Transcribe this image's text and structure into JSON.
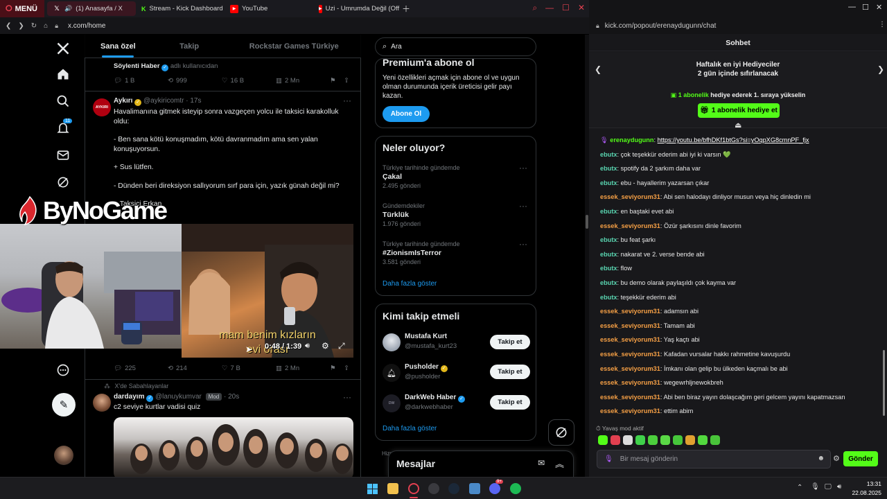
{
  "left_browser": {
    "menu_label": "MENÜ",
    "tabs": [
      {
        "label": "(1) Anasayfa / X",
        "active": true
      },
      {
        "label": "Stream - Kick Dashboard",
        "active": false
      },
      {
        "label": "YouTube",
        "active": false
      },
      {
        "label": "Uzi - Umrumda Değil (Off",
        "active": false
      }
    ],
    "url": "x.com/home"
  },
  "x": {
    "notif_count": "11",
    "timeline_tabs": [
      "Sana özel",
      "Takip",
      "Rockstar Games Türkiye"
    ],
    "tweet0": {
      "author": "Söylenti Haber",
      "handle": "adlı kullanıcıdan",
      "replies": "1 B",
      "retweets": "999",
      "likes": "16 B",
      "views": "2 Mn"
    },
    "tweet1": {
      "author": "Aykırı",
      "handle": "@aykiricomtr · 17s",
      "avatar_text": "AYKIRI",
      "lines": [
        "Havalimanına gitmek isteyip sonra vazgeçen yolcu ile taksici karakolluk oldu:",
        "- Ben sana kötü konuşmadım, kötü davranmadım ama sen yalan konuşuyorsun.",
        "+ Sus lütfen.",
        "- Dünden beri direksiyon sallıyorum sırf para için, yazık günah değil mi?",
        "+ Taksici Erkan"
      ],
      "video_subtitle_1": "mam benim kızların",
      "video_subtitle_2": "evi orası",
      "video_time": "0:48 / 1:39",
      "replies": "225",
      "retweets": "214",
      "likes": "7 B",
      "views": "2 Mn"
    },
    "tweet2": {
      "context": "X'de Sabahlayanlar",
      "author": "dardayım",
      "handle": "@lanuykumvar",
      "badge": "Mod",
      "time": "20s",
      "text": "c2 seviye kurtlar vadisi quiz"
    },
    "search_placeholder": "Ara",
    "premium": {
      "title": "Premium'a abone ol",
      "desc": "Yeni özellikleri açmak için abone ol ve uygun olman durumunda içerik üreticisi gelir payı kazan.",
      "button": "Abone Ol"
    },
    "trends": {
      "title": "Neler oluyor?",
      "items": [
        {
          "meta": "Türkiye tarihinde gündemde",
          "name": "Çakal",
          "count": "2.495 gönderi"
        },
        {
          "meta": "Gündemdekiler",
          "name": "Türklük",
          "count": "1.976 gönderi"
        },
        {
          "meta": "Türkiye tarihinde gündemde",
          "name": "#ZionismIsTerror",
          "count": "3.581 gönderi"
        }
      ],
      "more": "Daha fazla göster"
    },
    "who_to_follow": {
      "title": "Kimi takip etmeli",
      "items": [
        {
          "name": "Mustafa Kurt",
          "handle": "@mustafa_kurt23",
          "button": "Takip et"
        },
        {
          "name": "Pusholder",
          "handle": "@pusholder",
          "button": "Takip et"
        },
        {
          "name": "DarkWeb Haber",
          "handle": "@darkwebhaber",
          "button": "Takip et"
        }
      ],
      "more": "Daha fazla göster"
    },
    "messages_label": "Mesajlar",
    "footer_snippet": "Hizm"
  },
  "overlay": {
    "logo_text": "ByNoGame"
  },
  "kick": {
    "url": "kick.com/popout/erenaydugunn/chat",
    "chat_title": "Sohbet",
    "gifters_title": "Haftalık en iyi Hediyeciler",
    "gifters_subtitle": "2 gün içinde sıfırlanacak",
    "gift_promo_bold": "1 abonelik",
    "gift_promo_rest": " hediye ederek 1. sıraya yükselin",
    "gift_button": "1 abonelik hediye et",
    "messages": [
      {
        "user": "erenaydugunn",
        "text": "https://youtu.be/bfhDKf1btGs?si=yOqpXG8cmnPF_fjx",
        "color": "#53fc18",
        "link": true
      },
      {
        "user": "ebutx",
        "text": "çok teşekkür ederim abi iyi ki varsın 💚",
        "color": "#59d4b0"
      },
      {
        "user": "ebutx",
        "text": "spotify da 2 şarkım daha var",
        "color": "#59d4b0"
      },
      {
        "user": "ebutx",
        "text": "ebu - hayallerim yazarsan çıkar",
        "color": "#59d4b0"
      },
      {
        "user": "essek_seviyorum31",
        "text": "Abi sen halodayı dinliyor musun veya hiç dinledin mi",
        "color": "#f59f45"
      },
      {
        "user": "ebutx",
        "text": "en baştaki evet abi",
        "color": "#59d4b0"
      },
      {
        "user": "essek_seviyorum31",
        "text": "Özür şarkısını dinle favorim",
        "color": "#f59f45"
      },
      {
        "user": "ebutx",
        "text": "bu feat şarkı",
        "color": "#59d4b0"
      },
      {
        "user": "ebutx",
        "text": "nakarat ve 2. verse bende abi",
        "color": "#59d4b0"
      },
      {
        "user": "ebutx",
        "text": "flow",
        "color": "#59d4b0"
      },
      {
        "user": "ebutx",
        "text": "bu demo olarak paylaşıldı çok kayma var",
        "color": "#59d4b0"
      },
      {
        "user": "ebutx",
        "text": "teşekkür ederim abi",
        "color": "#59d4b0"
      },
      {
        "user": "essek_seviyorum31",
        "text": "adamsın abi",
        "color": "#f59f45"
      },
      {
        "user": "essek_seviyorum31",
        "text": "Tamam abi",
        "color": "#f59f45"
      },
      {
        "user": "essek_seviyorum31",
        "text": "Yaş kaçtı abi",
        "color": "#f59f45"
      },
      {
        "user": "essek_seviyorum31",
        "text": "Kafadan vursalar hakkı rahmetine kavuşurdu",
        "color": "#f59f45"
      },
      {
        "user": "essek_seviyorum31",
        "text": "İmkanı olan gelip bu ülkeden kaçmalı be abi",
        "color": "#f59f45"
      },
      {
        "user": "essek_seviyorum31",
        "text": "wegewrhljnewokbreh",
        "color": "#f59f45"
      },
      {
        "user": "essek_seviyorum31",
        "text": "Abi ben biraz yayın dolaşcağım geri gelcem yayını kapatmazsan",
        "color": "#f59f45"
      },
      {
        "user": "essek_seviyorum31",
        "text": "ettim abim",
        "color": "#f59f45"
      }
    ],
    "slow_mode": "Yavaş mod aktif",
    "input_placeholder": "Bir mesaj gönderin",
    "send_button": "Gönder"
  },
  "taskbar": {
    "time": "13:31",
    "date": "22.08.2025",
    "discord_badge": "9+"
  },
  "colors": {
    "x_blue": "#1d9bf0",
    "kick_green": "#53fc18",
    "opera_red": "#e24050"
  }
}
